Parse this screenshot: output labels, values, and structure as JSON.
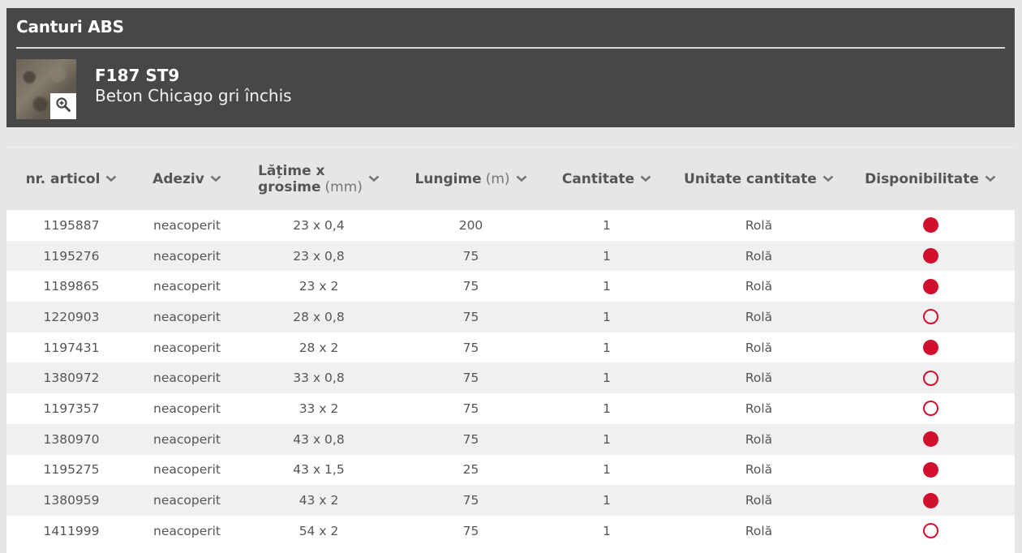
{
  "panel": {
    "title": "Canturi ABS",
    "product_code": "F187 ST9",
    "product_name": "Beton Chicago gri închis"
  },
  "table": {
    "columns": [
      {
        "label": "nr. articol",
        "unit": ""
      },
      {
        "label": "Adeziv",
        "unit": ""
      },
      {
        "label_line1": "Lățime x",
        "label_line2": "grosime",
        "unit": "(mm)"
      },
      {
        "label": "Lungime",
        "unit": "(m)"
      },
      {
        "label": "Cantitate",
        "unit": ""
      },
      {
        "label": "Unitate cantitate",
        "unit": ""
      },
      {
        "label": "Disponibilitate",
        "unit": ""
      }
    ],
    "rows": [
      {
        "article": "1195887",
        "adhesive": "neacoperit",
        "size": "23 x 0,4",
        "length": "200",
        "qty": "1",
        "unit": "Rolă",
        "available": true
      },
      {
        "article": "1195276",
        "adhesive": "neacoperit",
        "size": "23 x 0,8",
        "length": "75",
        "qty": "1",
        "unit": "Rolă",
        "available": true
      },
      {
        "article": "1189865",
        "adhesive": "neacoperit",
        "size": "23 x 2",
        "length": "75",
        "qty": "1",
        "unit": "Rolă",
        "available": true
      },
      {
        "article": "1220903",
        "adhesive": "neacoperit",
        "size": "28 x 0,8",
        "length": "75",
        "qty": "1",
        "unit": "Rolă",
        "available": false
      },
      {
        "article": "1197431",
        "adhesive": "neacoperit",
        "size": "28 x 2",
        "length": "75",
        "qty": "1",
        "unit": "Rolă",
        "available": true
      },
      {
        "article": "1380972",
        "adhesive": "neacoperit",
        "size": "33 x 0,8",
        "length": "75",
        "qty": "1",
        "unit": "Rolă",
        "available": false
      },
      {
        "article": "1197357",
        "adhesive": "neacoperit",
        "size": "33 x 2",
        "length": "75",
        "qty": "1",
        "unit": "Rolă",
        "available": false
      },
      {
        "article": "1380970",
        "adhesive": "neacoperit",
        "size": "43 x 0,8",
        "length": "75",
        "qty": "1",
        "unit": "Rolă",
        "available": true
      },
      {
        "article": "1195275",
        "adhesive": "neacoperit",
        "size": "43 x 1,5",
        "length": "25",
        "qty": "1",
        "unit": "Rolă",
        "available": true
      },
      {
        "article": "1380959",
        "adhesive": "neacoperit",
        "size": "43 x 2",
        "length": "75",
        "qty": "1",
        "unit": "Rolă",
        "available": true
      },
      {
        "article": "1411999",
        "adhesive": "neacoperit",
        "size": "54 x 2",
        "length": "75",
        "qty": "1",
        "unit": "Rolă",
        "available": false
      }
    ]
  },
  "colors": {
    "panel_bg": "#474747",
    "availability_red": "#d0102d"
  },
  "icons": {
    "zoom": "magnifier-plus-icon",
    "sort": "chevron-down-icon",
    "available": "filled-circle-icon",
    "unavailable": "empty-circle-icon"
  }
}
